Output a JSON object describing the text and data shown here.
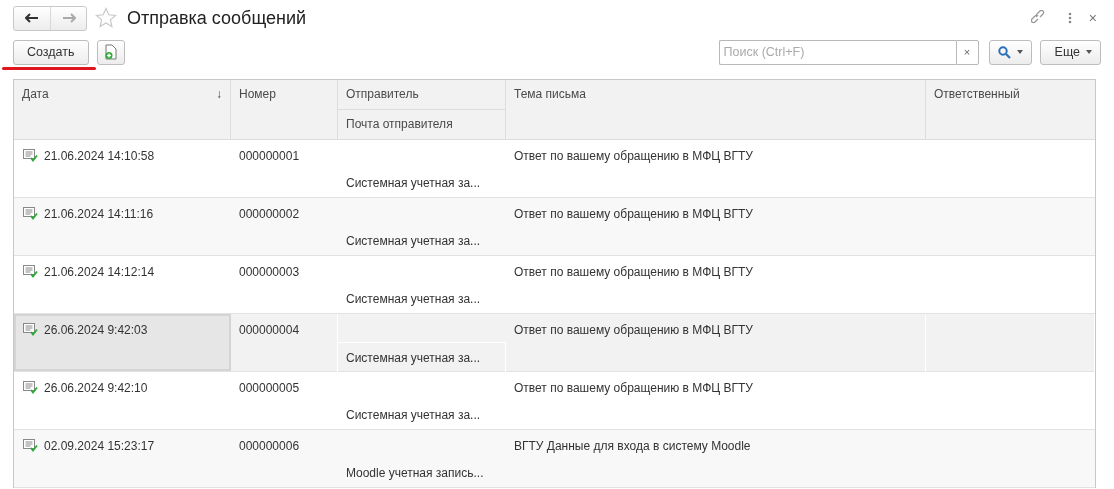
{
  "window": {
    "title": "Отправка сообщений",
    "back_disabled": false,
    "forward_disabled": true,
    "favorite": false,
    "close": "×"
  },
  "toolbar": {
    "create_button": "Создать",
    "search": {
      "placeholder": "Поиск (Ctrl+F)",
      "clear": "×"
    },
    "more_button": "Еще"
  },
  "table": {
    "columns": [
      {
        "label": "Дата",
        "sort_mark": "↓"
      },
      {
        "label": "Номер"
      },
      {
        "label": "Отправитель",
        "sub_label": "Почта отправителя"
      },
      {
        "label": "Тема письма"
      },
      {
        "label": "Ответственный"
      }
    ],
    "rows": [
      {
        "date": "21.06.2024 14:10:58",
        "number": "000000001",
        "sender_email": "Системная учетная за...",
        "subject": "Ответ по вашему обращению в МФЦ ВГТУ",
        "selected": false
      },
      {
        "date": "21.06.2024 14:11:16",
        "number": "000000002",
        "sender_email": "Системная учетная за...",
        "subject": "Ответ по вашему обращению в МФЦ ВГТУ",
        "selected": false
      },
      {
        "date": "21.06.2024 14:12:14",
        "number": "000000003",
        "sender_email": "Системная учетная за...",
        "subject": "Ответ по вашему обращению в МФЦ ВГТУ",
        "selected": false
      },
      {
        "date": "26.06.2024 9:42:03",
        "number": "000000004",
        "sender_email": "Системная учетная за...",
        "subject": "Ответ по вашему обращению в МФЦ ВГТУ",
        "selected": true
      },
      {
        "date": "26.06.2024 9:42:10",
        "number": "000000005",
        "sender_email": "Системная учетная за...",
        "subject": "Ответ по вашему обращению в МФЦ ВГТУ",
        "selected": false
      },
      {
        "date": "02.09.2024 15:23:17",
        "number": "000000006",
        "sender_email": "Moodle учетная запись...",
        "subject": "ВГТУ Данные для входа в систему Moodle",
        "selected": false
      }
    ]
  }
}
